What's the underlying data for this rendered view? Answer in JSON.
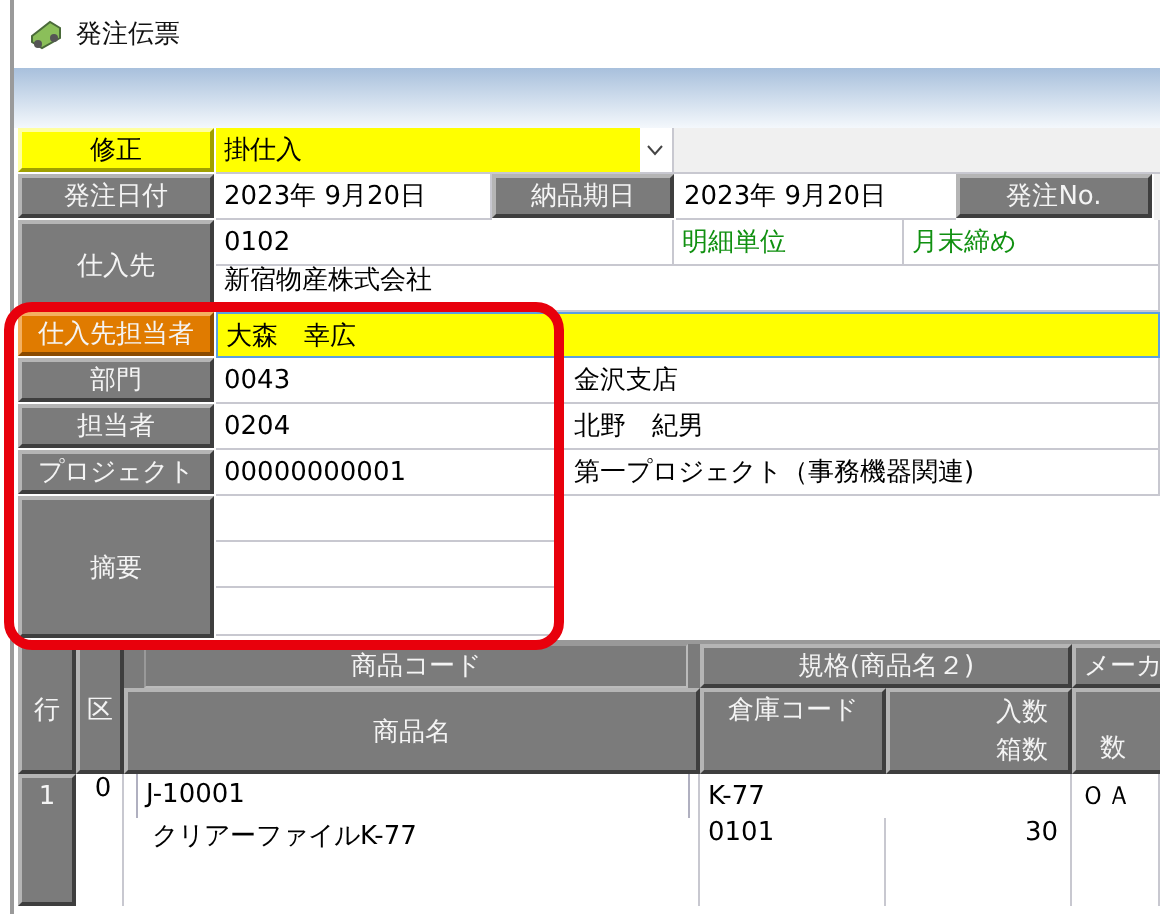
{
  "window": {
    "title": "発注伝票"
  },
  "header": {
    "mode": {
      "label": "修正",
      "value": "掛仕入"
    },
    "order_date": {
      "label": "発注日付",
      "value": "2023年 9月20日"
    },
    "delivery_date": {
      "label": "納品期日",
      "value": "2023年 9月20日"
    },
    "order_no_button": "発注No.",
    "supplier": {
      "label": "仕入先",
      "code": "0102",
      "detail_unit": "明細単位",
      "closing": "月末締め",
      "name": "新宿物産株式会社"
    },
    "fields": [
      {
        "label": "仕入先担当者",
        "value": "大森　幸広",
        "focused": true
      },
      {
        "label": "部門",
        "code": "0043",
        "name": "金沢支店",
        "focused": false
      },
      {
        "label": "担当者",
        "code": "0204",
        "name": "北野　紀男",
        "focused": false
      },
      {
        "label": "プロジェクト",
        "code": "00000000001",
        "name": "第一プロジェクト（事務機器関連)",
        "focused": false
      }
    ],
    "memo": {
      "label": "摘要"
    }
  },
  "table": {
    "columns": {
      "line": "行",
      "kubun": "区",
      "code": "商品コード",
      "name": "商品名",
      "spec": "規格(商品名２)",
      "warehouse": "倉庫コード",
      "qty_per_box": "入数",
      "boxes": "箱数",
      "maker": "メーカ",
      "column_9": "数"
    },
    "rows": [
      {
        "line": "1",
        "kubun": "0",
        "code": "J-10001",
        "name": "クリアーファイルK-77",
        "spec": "K-77",
        "warehouse": "0101",
        "qty_per_box": "30",
        "maker": "ＯＡ"
      }
    ]
  }
}
